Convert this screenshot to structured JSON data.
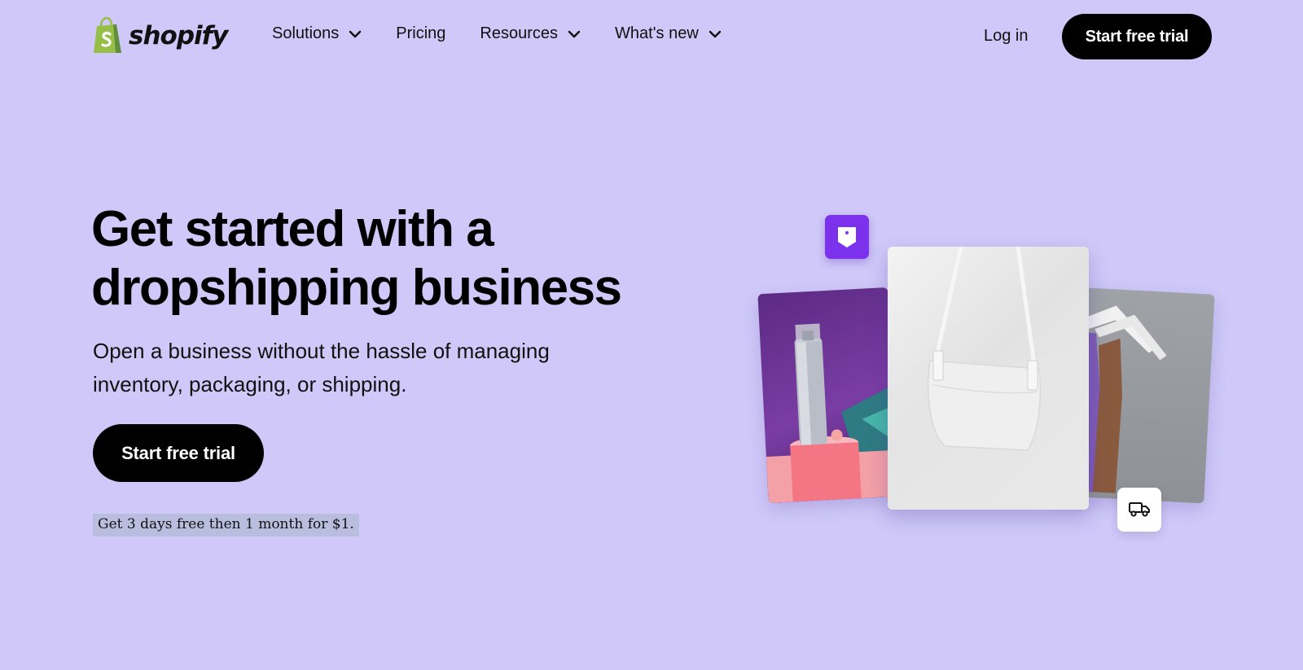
{
  "brand": {
    "name": "shopify",
    "green": "#95bf47",
    "dark_green": "#5e8e3e"
  },
  "nav": {
    "items": [
      {
        "label": "Solutions",
        "has_dropdown": true
      },
      {
        "label": "Pricing",
        "has_dropdown": false
      },
      {
        "label": "Resources",
        "has_dropdown": true
      },
      {
        "label": "What's new",
        "has_dropdown": true
      }
    ],
    "login_label": "Log in",
    "cta_label": "Start free trial"
  },
  "hero": {
    "title": "Get started with a dropshipping business",
    "subtitle": "Open a business without the hassle of managing inventory, packaging, or shipping.",
    "cta_label": "Start free trial",
    "promo_text": "Get 3 days free then 1 month for $1."
  },
  "illustration": {
    "tag_icon": "price-tag-icon",
    "truck_icon": "delivery-truck-icon",
    "accent": "#7c31ec",
    "background": "#cfc8f8"
  }
}
